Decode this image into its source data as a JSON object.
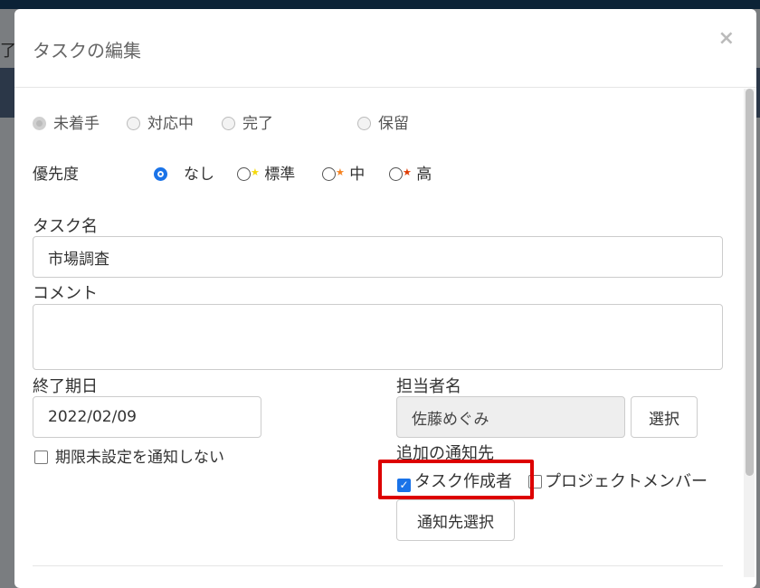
{
  "background": {
    "partial_text": "了"
  },
  "modal": {
    "title": "タスクの編集",
    "close": "×"
  },
  "status": {
    "options": [
      "未着手",
      "対応中",
      "完了",
      "保留"
    ],
    "selected": "未着手"
  },
  "priority": {
    "label": "優先度",
    "options": [
      {
        "label": "なし",
        "star_color": null
      },
      {
        "label": "標準",
        "star_color": "#f5d90a"
      },
      {
        "label": "中",
        "star_color": "#f58220"
      },
      {
        "label": "高",
        "star_color": "#e03a00"
      }
    ],
    "selected": "なし",
    "star": "★"
  },
  "task_name": {
    "label": "タスク名",
    "value": "市場調査"
  },
  "comment": {
    "label": "コメント",
    "value": ""
  },
  "due_date": {
    "label": "終了期日",
    "value": "2022/02/09",
    "no_notify_label": "期限未設定を通知しない",
    "no_notify_checked": false
  },
  "assignee": {
    "label": "担当者名",
    "value": "佐藤めぐみ",
    "select_button": "選択"
  },
  "notify": {
    "label": "追加の通知先",
    "task_creator": "タスク作成者",
    "task_creator_checked": true,
    "project_members": "プロジェクトメンバー",
    "project_members_checked": false,
    "select_button": "通知先選択",
    "check": "✓"
  }
}
